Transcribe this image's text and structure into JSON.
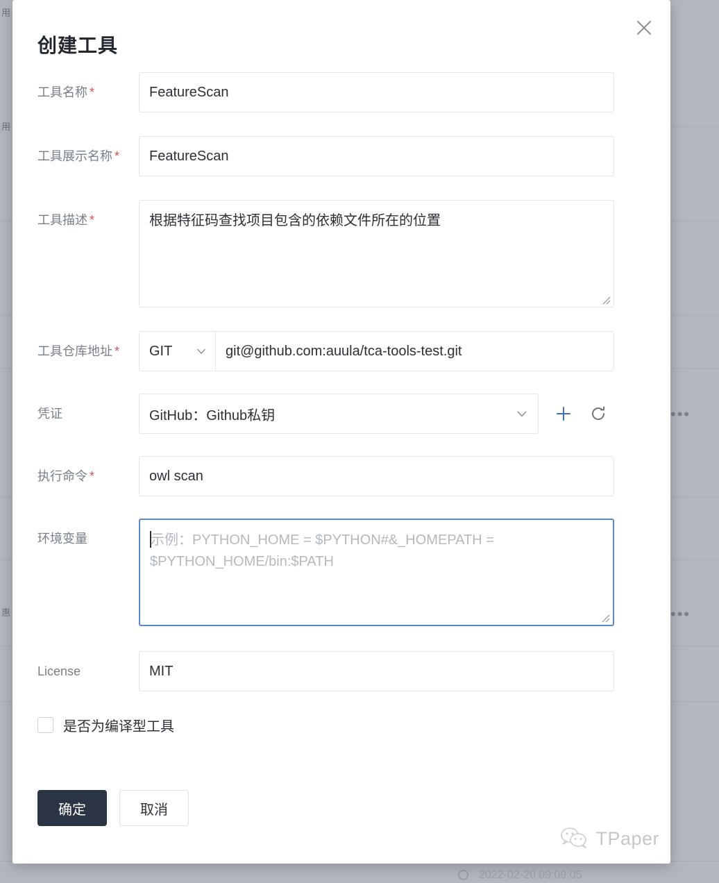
{
  "dialog": {
    "title": "创建工具",
    "close_icon": "close-icon"
  },
  "form": {
    "tool_name": {
      "label": "工具名称",
      "required": "*",
      "value": "FeatureScan"
    },
    "display_name": {
      "label": "工具展示名称",
      "required": "*",
      "value": "FeatureScan"
    },
    "description": {
      "label": "工具描述",
      "required": "*",
      "value": "根据特征码查找项目包含的依赖文件所在的位置"
    },
    "repo": {
      "label": "工具仓库地址",
      "required": "*",
      "scm_type": "GIT",
      "scm_chevron": "chevron-down-icon",
      "url": "git@github.com:auula/tca-tools-test.git"
    },
    "credential": {
      "label": "凭证",
      "value": "GitHub：Github私钥",
      "chevron": "chevron-down-icon",
      "add_icon": "plus-icon",
      "refresh_icon": "refresh-icon",
      "add_color": "#3d6fd1"
    },
    "command": {
      "label": "执行命令",
      "required": "*",
      "value": "owl scan"
    },
    "env": {
      "label": "环境变量",
      "value": "",
      "placeholder": "示例：PYTHON_HOME = $PYTHON#&_HOMEPATH = $PYTHON_HOME/bin:$PATH",
      "focus_color": "#5a86d8"
    },
    "license": {
      "label": "License",
      "value": "MIT"
    },
    "compiled": {
      "label": "是否为编译型工具",
      "checked": false
    }
  },
  "footer": {
    "confirm_label": "确定",
    "cancel_label": "取消",
    "confirm_color": "#2b3445"
  },
  "watermark": {
    "text": "TPaper",
    "icon": "wechat-icon"
  },
  "background": {
    "timestamp": "2022-02-20 09:09:05"
  }
}
